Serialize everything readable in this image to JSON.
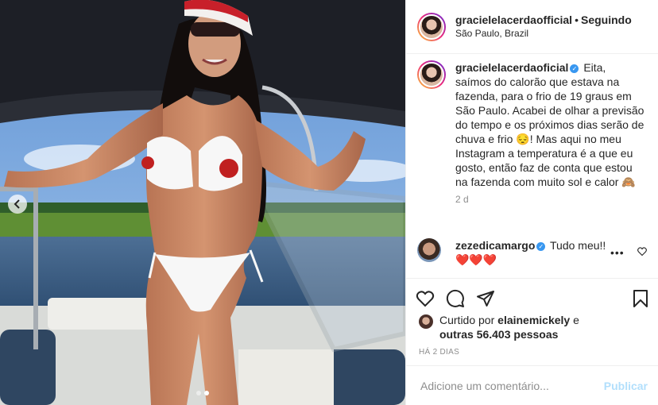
{
  "post": {
    "username": "gracielelacerdaofficial",
    "follow_status": "Seguindo",
    "separator": "•",
    "location": "São Paulo, Brazil"
  },
  "caption": {
    "username": "gracielelacerdaoficial",
    "text_part1": "Eita, saímos do calorão que estava na fazenda, para o frio de 19 graus em São Paulo. Acabei de olhar a previsão do tempo e os próximos dias serão de chuva e frio ",
    "emoji1": "😔",
    "text_part2": "! Mas aqui no meu Instagram a temperatura é a que eu gosto, então faz de conta que estou na fazenda com muito sol e calor ",
    "emoji2": "🙈",
    "time": "2 d"
  },
  "comment": {
    "username": "zezedicamargo",
    "text": "Tudo meu!!",
    "hearts": "❤️❤️❤️",
    "more": "•••"
  },
  "likes": {
    "prefix": "Curtido por",
    "user": "elainemickely",
    "conj": "e",
    "others": "outras 56.403 pessoas"
  },
  "date": "HÁ 2 DIAS",
  "add_comment": {
    "placeholder": "Adicione um comentário...",
    "publish": "Publicar"
  },
  "carousel": {
    "total": 2,
    "active": 2
  },
  "colors": {
    "accent": "#3897f0",
    "publish_disabled": "#b2dffc",
    "muted": "#8e8e8e"
  },
  "icons": [
    "chevron-left-icon",
    "heart-icon",
    "comment-icon",
    "share-icon",
    "bookmark-icon",
    "verified-icon"
  ]
}
